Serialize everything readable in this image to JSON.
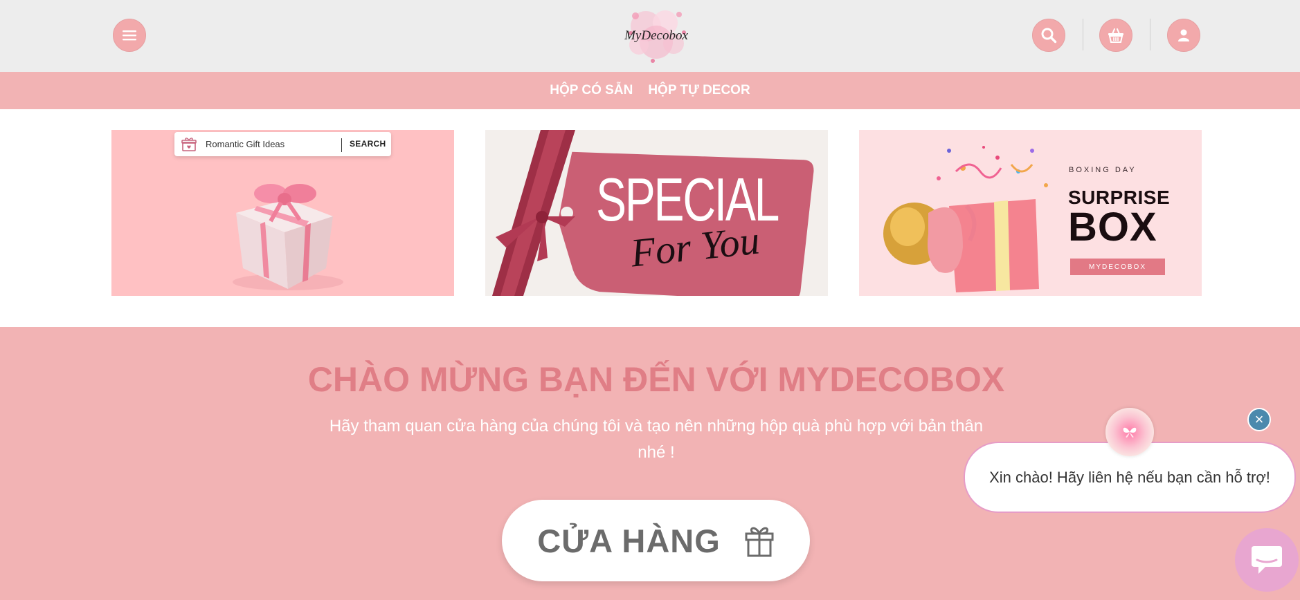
{
  "header": {
    "logo_text": "MyDecobox",
    "icons": [
      "menu-icon",
      "search-icon",
      "basket-icon",
      "user-icon"
    ]
  },
  "nav": {
    "items": [
      {
        "label": "HỘP CÓ SẴN"
      },
      {
        "label": "HỘP TỰ DECOR"
      }
    ]
  },
  "banners": {
    "search_text": "Romantic Gift Ideas",
    "search_button": "SEARCH",
    "special_title": "SPECIAL",
    "special_sub": "For You",
    "boxing_day": "BOXING DAY",
    "surprise": "SURPRISE",
    "box": "BOX",
    "brand_tag": "MYDECOBOX"
  },
  "welcome": {
    "title": "CHÀO MỪNG BẠN ĐẾN VỚI MYDECOBOX",
    "subtitle": "Hãy tham quan cửa hàng của chúng tôi và tạo nên những hộp quà phù hợp với bản thân nhé !",
    "shop_button": "CỬA HÀNG"
  },
  "chat": {
    "message": "Xin chào! Hãy liên hệ nếu bạn cần hỗ trợ!",
    "close_symbol": "×"
  },
  "colors": {
    "accent": "#f2b3b4",
    "title": "#e07e86",
    "header_bg": "#ededed",
    "icon_btn": "#f2a9ab",
    "chat_border": "#e69cc7",
    "close_btn": "#4b89ad"
  }
}
